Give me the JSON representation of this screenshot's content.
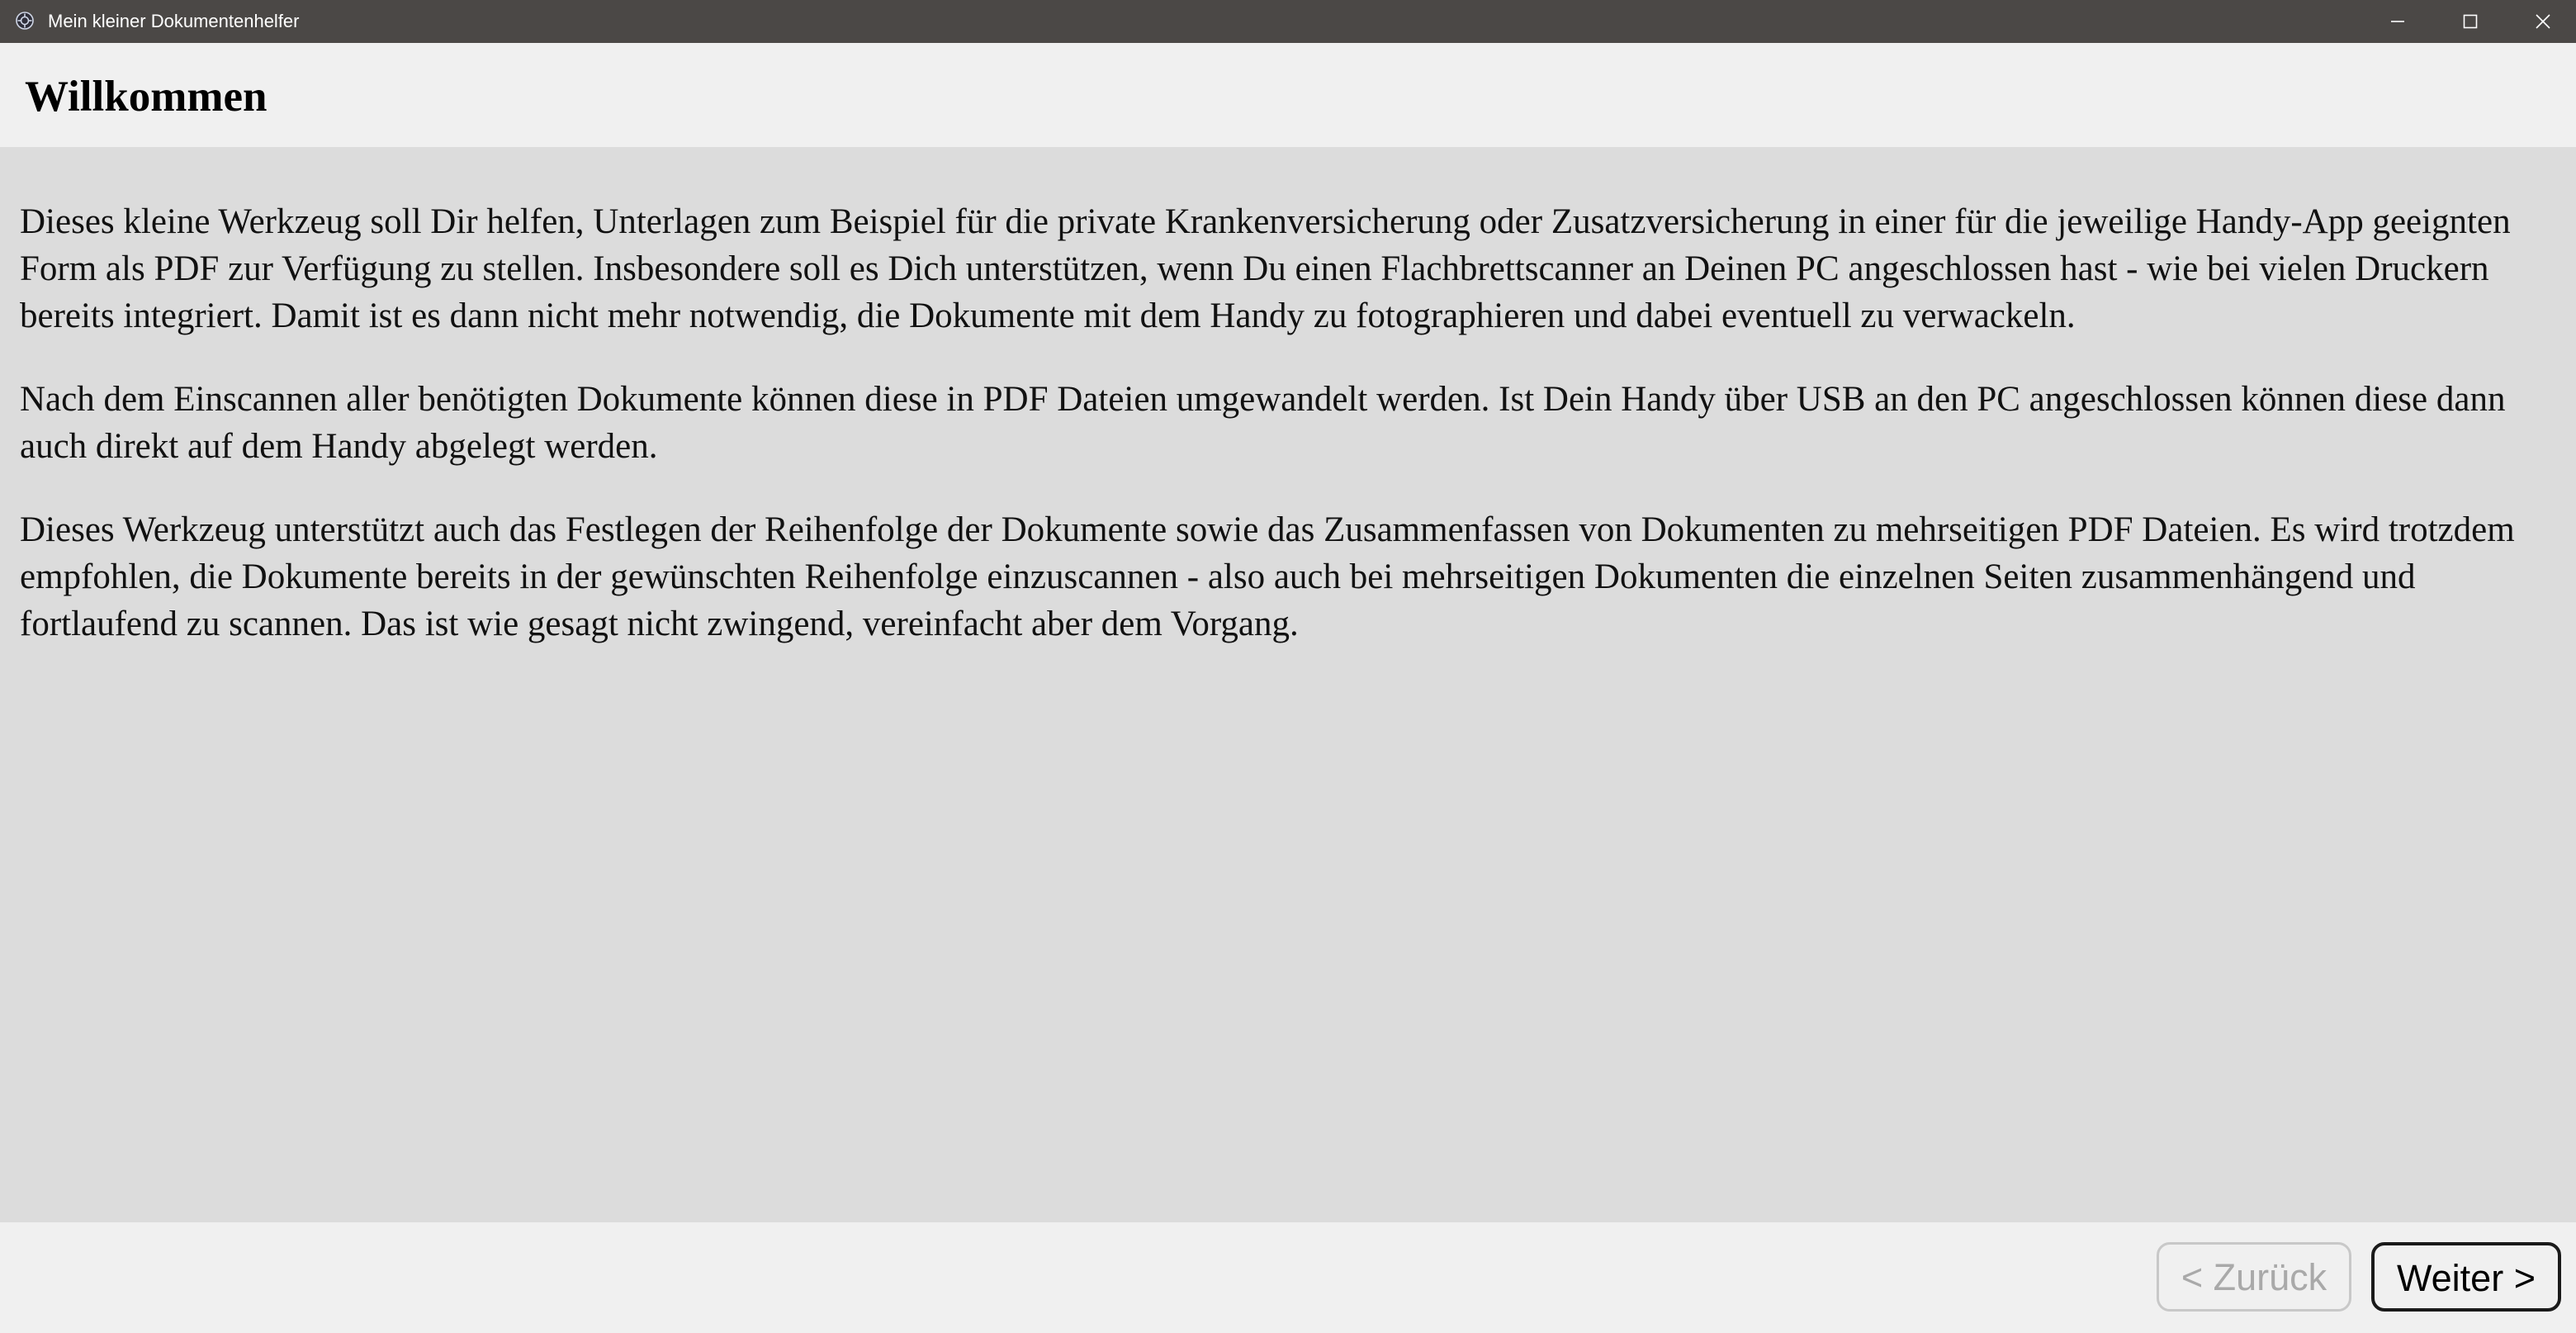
{
  "window": {
    "title": "Mein kleiner Dokumentenhelfer",
    "icon": "app-gear-icon",
    "controls": [
      "minimize-icon",
      "maximize-icon",
      "close-icon"
    ]
  },
  "header": {
    "title": "Willkommen"
  },
  "main": {
    "paragraphs": [
      "Dieses kleine Werkzeug soll Dir helfen, Unterlagen zum Beispiel für die private Krankenversicherung oder Zusatzversicherung in einer für die jeweilige Handy-App geeignten Form als PDF zur Verfügung zu stellen. Insbesondere soll es Dich unterstützen, wenn Du einen Flachbrettscanner an Deinen PC angeschlossen hast - wie bei vielen Druckern bereits integriert. Damit ist es dann nicht mehr notwendig, die Dokumente mit dem Handy zu fotographieren und dabei eventuell zu verwackeln.",
      "Nach dem Einscannen aller benötigten Dokumente können diese in PDF Dateien umgewandelt werden. Ist Dein Handy über USB an den PC angeschlossen können diese dann auch direkt auf dem Handy abgelegt werden.",
      "Dieses Werkzeug unterstützt auch das Festlegen der Reihenfolge der Dokumente sowie das Zusammenfassen von Dokumenten zu mehrseitigen PDF Dateien. Es wird trotzdem empfohlen, die Dokumente bereits in der gewünschten Reihenfolge einzuscannen - also auch bei mehrseitigen Dokumenten die einzelnen Seiten zusammenhängend und fortlaufend zu scannen. Das ist wie gesagt nicht zwingend, vereinfacht aber dem Vorgang."
    ]
  },
  "footer": {
    "back_label": "< Zurück",
    "back_enabled": false,
    "next_label": "Weiter >",
    "next_enabled": true
  },
  "colors": {
    "titlebar": "#4b4846",
    "header_bg": "#f0f0f0",
    "content_bg": "#dcdcdc",
    "disabled_text": "#a9a9a9"
  }
}
